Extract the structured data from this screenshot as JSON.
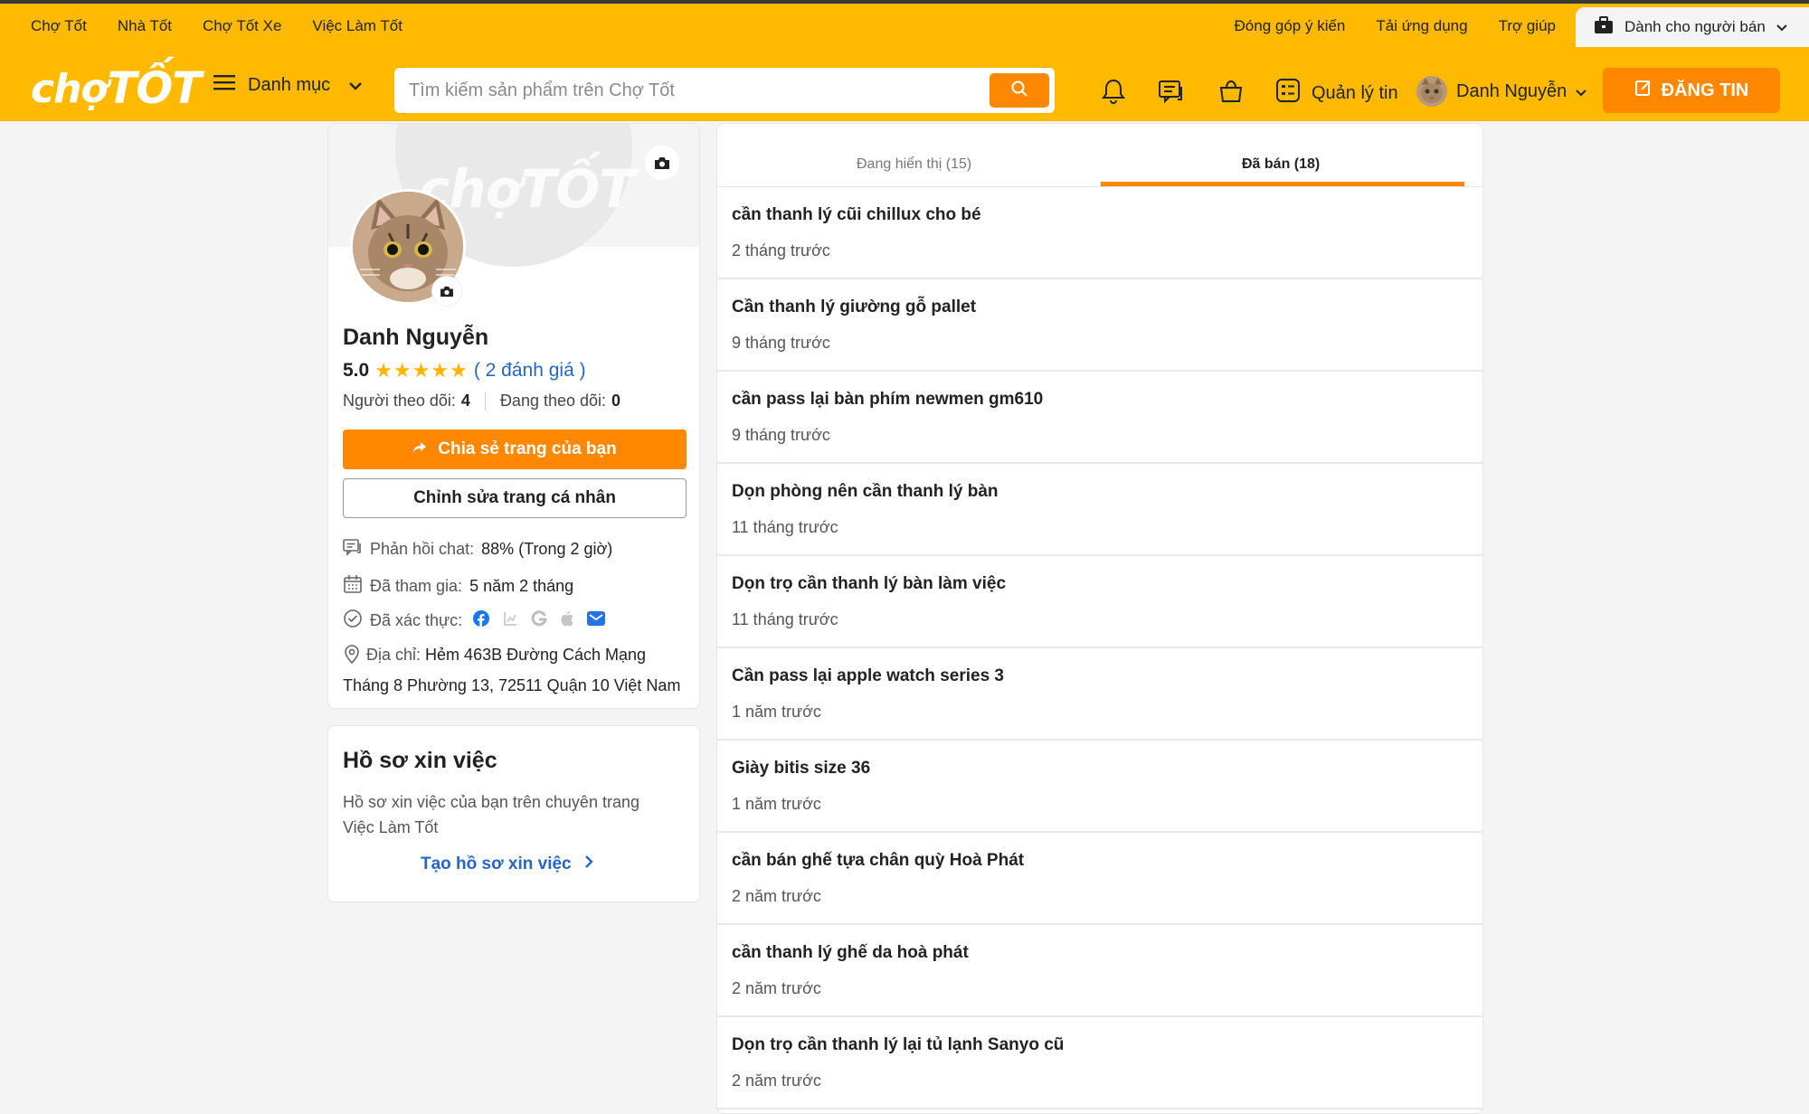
{
  "header": {
    "top_links_left": [
      "Chợ Tốt",
      "Nhà Tốt",
      "Chợ Tốt Xe",
      "Việc Làm Tốt"
    ],
    "top_links_right": [
      "Đóng góp ý kiến",
      "Tải ứng dụng",
      "Trợ giúp"
    ],
    "seller_button": "Dành cho người bán",
    "logo_part1": "chợ",
    "logo_part2": "TỐT",
    "menu_label": "Danh mục",
    "search_placeholder": "Tìm kiếm sản phẩm trên Chợ Tốt",
    "manage_label": "Quản lý tin",
    "user_name": "Danh Nguyễn",
    "post_label": "ĐĂNG TIN"
  },
  "profile": {
    "cover_logo": "chợTỐT",
    "name": "Danh Nguyễn",
    "rating_score": "5.0",
    "stars": "★★★★★",
    "rating_count": "( 2 đánh giá )",
    "followers_label": "Người theo dõi:",
    "followers_value": "4",
    "following_label": "Đang theo dõi:",
    "following_value": "0",
    "share_button": "Chia sẻ trang của bạn",
    "edit_button": "Chỉnh sửa trang cá nhân",
    "chat_label": "Phản hồi chat:",
    "chat_value": "88% (Trong 2 giờ)",
    "joined_label": "Đã tham gia:",
    "joined_value": "5 năm 2 tháng",
    "verified_label": "Đã xác thực:",
    "address_label": "Địa chỉ:",
    "address_line1": "Hẻm 463B Đường Cách Mạng",
    "address_line2": "Tháng 8 Phường 13, 72511 Quận 10 Việt Nam"
  },
  "job": {
    "title": "Hồ sơ xin việc",
    "desc_line1": "Hồ sơ xin việc của bạn trên chuyên trang",
    "desc_line2": "Việc Làm Tốt",
    "link": "Tạo hồ sơ xin việc"
  },
  "tabs": {
    "showing": "Đang hiển thị (15)",
    "sold": "Đã bán (18)"
  },
  "items": [
    {
      "title": "cần thanh lý cũi chillux cho bé",
      "time": "2 tháng trước"
    },
    {
      "title": "Cần thanh lý giường gỗ pallet",
      "time": "9 tháng trước"
    },
    {
      "title": "cần pass lại bàn phím newmen gm610",
      "time": "9 tháng trước"
    },
    {
      "title": "Dọn phòng nên cần thanh lý bàn",
      "time": "11 tháng trước"
    },
    {
      "title": "Dọn trọ cần thanh lý bàn làm việc",
      "time": "11 tháng trước"
    },
    {
      "title": "Cần pass lại apple watch series 3",
      "time": "1 năm trước"
    },
    {
      "title": "Giày bitis size 36",
      "time": "1 năm trước"
    },
    {
      "title": "cần bán ghế tựa chân quỳ Hoà Phát",
      "time": "2 năm trước"
    },
    {
      "title": "cần thanh lý ghế da hoà phát",
      "time": "2 năm trước"
    },
    {
      "title": "Dọn trọ cần thanh lý lại tủ lạnh Sanyo cũ",
      "time": "2 năm trước"
    }
  ],
  "colors": {
    "brand_yellow": "#ffba00",
    "accent_orange": "#ff8800",
    "link_blue": "#2565c7"
  }
}
